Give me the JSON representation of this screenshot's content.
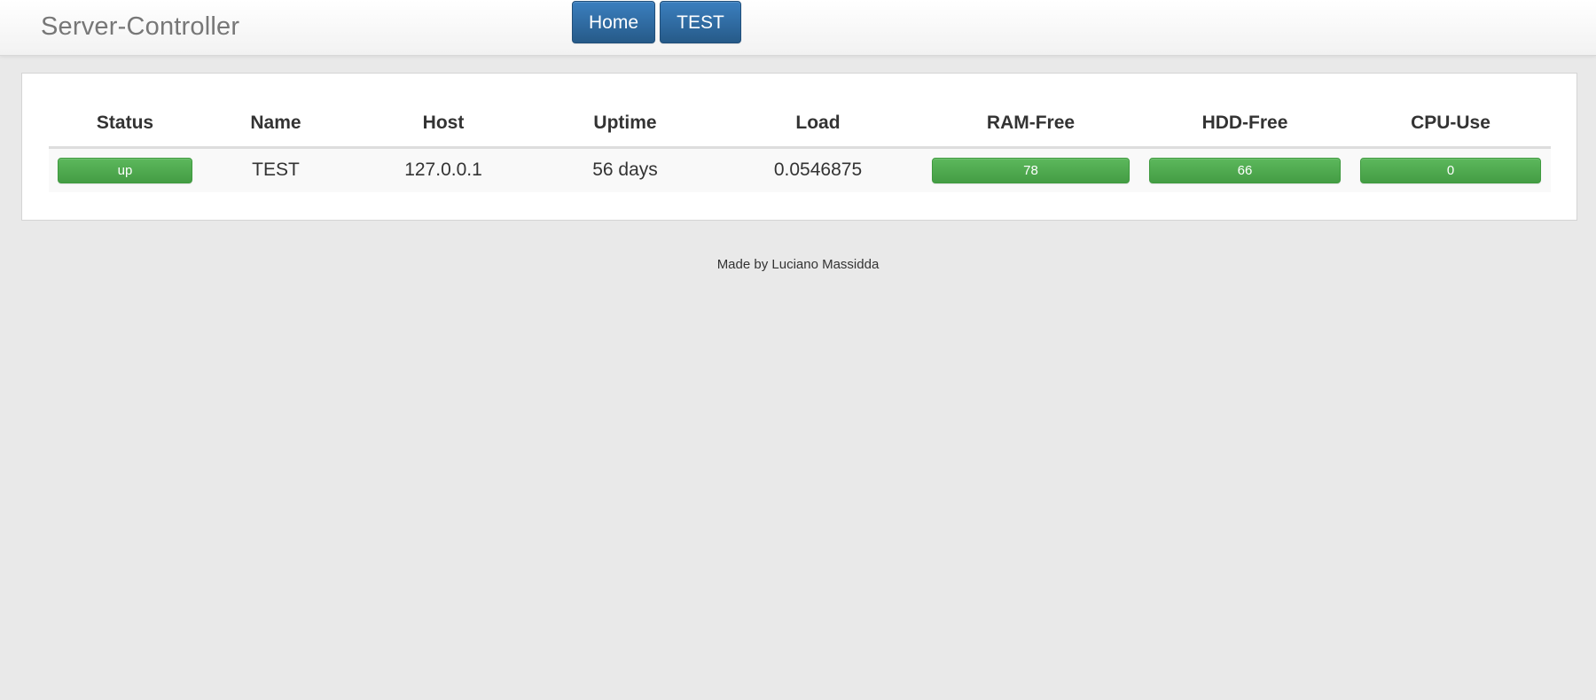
{
  "navbar": {
    "brand": "Server-Controller",
    "links": [
      "Home",
      "TEST"
    ]
  },
  "table": {
    "headers": [
      "Status",
      "Name",
      "Host",
      "Uptime",
      "Load",
      "RAM-Free",
      "HDD-Free",
      "CPU-Use"
    ],
    "rows": [
      {
        "status": "up",
        "name": "TEST",
        "host": "127.0.0.1",
        "uptime": "56 days",
        "load": "0.0546875",
        "ram_free": "78",
        "hdd_free": "66",
        "cpu_use": "0"
      }
    ]
  },
  "footer": {
    "text": "Made by Luciano Massidda"
  },
  "colors": {
    "nav_button": "#265a88",
    "status_bar": "#5cb85c",
    "brand_text": "#777777",
    "background": "#e9e9e9"
  }
}
